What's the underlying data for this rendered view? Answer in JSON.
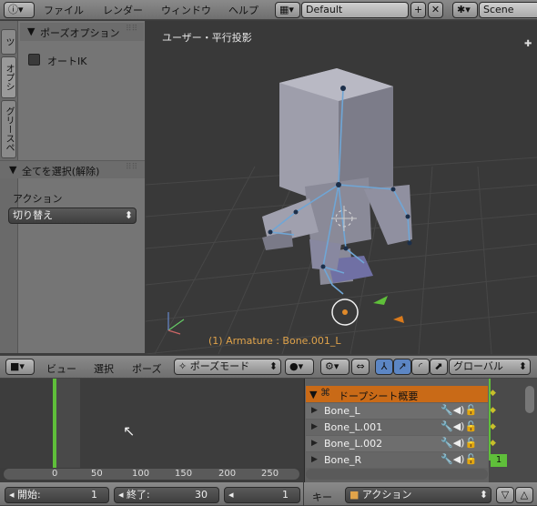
{
  "topbar": {
    "menus": [
      "ファイル",
      "レンダー",
      "ウィンドウ",
      "ヘルプ"
    ],
    "screen_layout": "Default",
    "scene": "Scene"
  },
  "toolshelf": {
    "tabs": [
      "ツ",
      "オプシ",
      "グリースペ"
    ],
    "pose_options_title": "ポーズオプション",
    "auto_ik_label": "オートIK",
    "select_all_title": "全てを選択(解除)",
    "action_label": "アクション",
    "action_value": "切り替え"
  },
  "viewport": {
    "view_label": "ユーザー・平行投影",
    "object_info": "(1) Armature : Bone.001_L"
  },
  "view3d_header": {
    "menus": [
      "ビュー",
      "選択",
      "ポーズ"
    ],
    "mode": "ポーズモード",
    "orientation": "グローバル"
  },
  "timeline": {
    "ticks": [
      "0",
      "50",
      "100",
      "150",
      "200",
      "250"
    ],
    "start_label": "開始:",
    "start_value": "1",
    "end_label": "終了:",
    "end_value": "30",
    "current_frame": "1"
  },
  "dopesheet": {
    "summary": "ドープシート概要",
    "channels": [
      "Bone_L",
      "Bone_L.001",
      "Bone_L.002",
      "Bone_R"
    ],
    "frame_badge": "1",
    "keys_label": "キー",
    "mode": "アクション"
  },
  "colors": {
    "accent": "#d97a1c",
    "bone": "#6fa6d6",
    "playhead": "#5fbf3a"
  }
}
